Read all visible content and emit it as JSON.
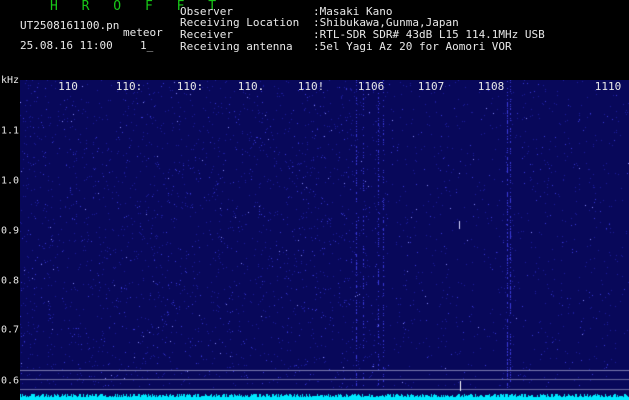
{
  "header": {
    "logo": "H R O F F T",
    "filename": "UT2508161100.pn",
    "meteor_label": "meteor",
    "datetime": "25.08.16 11:00",
    "count": "1_"
  },
  "info": {
    "observer_label": "Observer",
    "observer_value": ":Masaki Kano",
    "location_label": "Receiving Location",
    "location_value": ":Shibukawa,Gunma,Japan",
    "receiver_label": "Receiver",
    "receiver_value": ":RTL-SDR SDR# 43dB L15 114.1MHz USB",
    "antenna_label": "Receiving antenna",
    "antenna_value": ":5el Yagi Az 20 for Aomori VOR"
  },
  "axis": {
    "y_unit": "kHz",
    "x_ticks": [
      "110",
      "110:",
      "110:",
      "110.",
      "110!",
      "1106",
      "1107",
      "1108",
      "1110"
    ],
    "y_ticks": [
      "1.1",
      "1.0",
      "0.9",
      "0.8",
      "0.7",
      "0.6"
    ]
  },
  "colors": {
    "background": "#000000",
    "waterfall": "#08085a",
    "noise": "#3a3ad8",
    "signal": "#00e8ff",
    "logo": "#18c818",
    "text": "#e8e8e8"
  }
}
